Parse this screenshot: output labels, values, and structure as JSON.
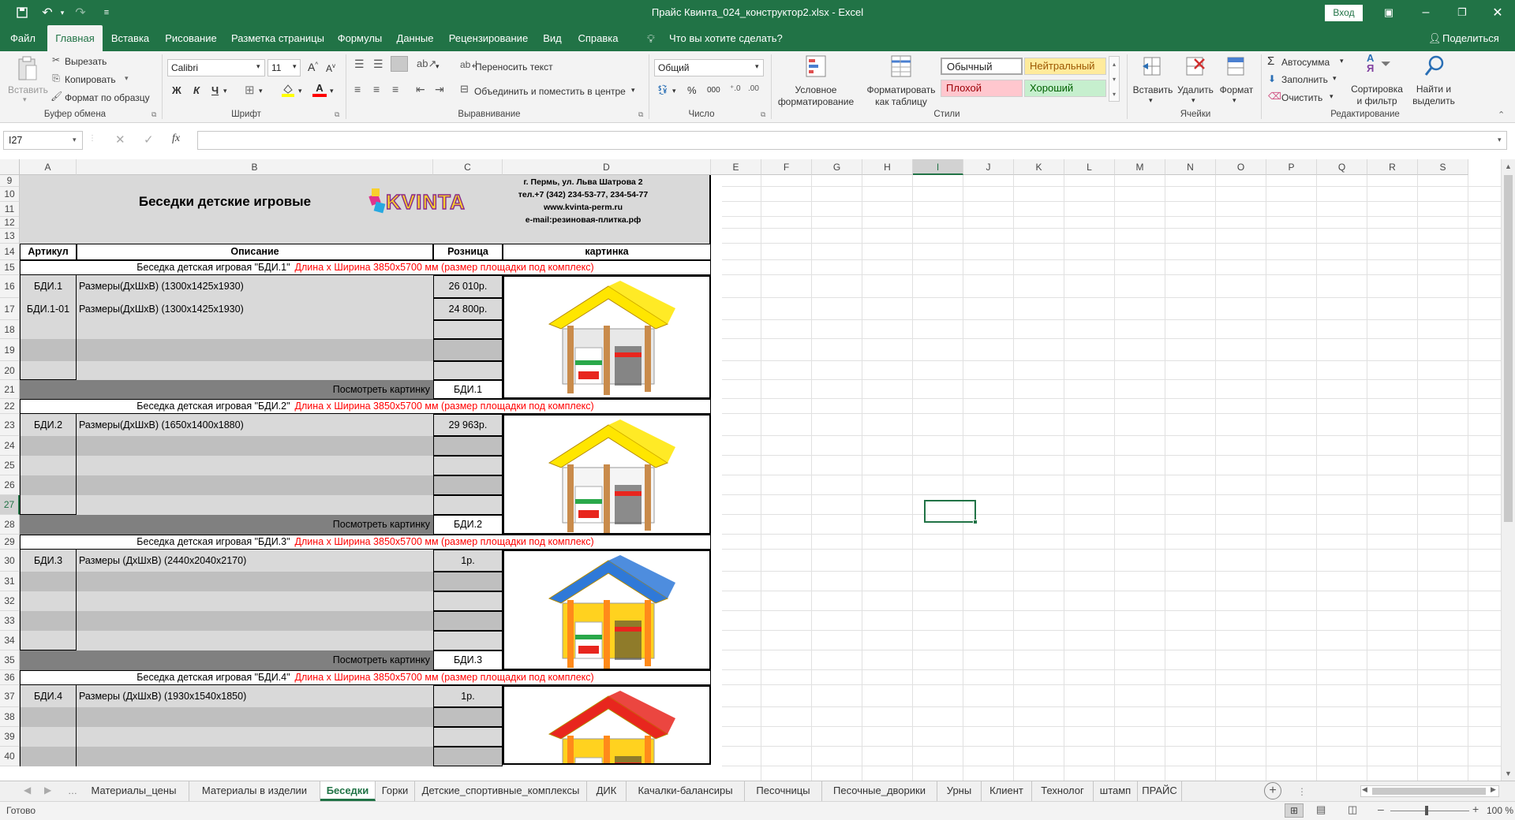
{
  "titlebar": {
    "title": "Прайс Квинта_024_конструктор2.xlsx  -  Excel",
    "signin": "Вход"
  },
  "ribbon_tabs": [
    "Файл",
    "Главная",
    "Вставка",
    "Рисование",
    "Разметка страницы",
    "Формулы",
    "Данные",
    "Рецензирование",
    "Вид",
    "Справка"
  ],
  "tell_me": "Что вы хотите сделать?",
  "share": "Поделиться",
  "clipboard": {
    "paste": "Вставить",
    "cut": "Вырезать",
    "copy": "Копировать",
    "format_painter": "Формат по образцу",
    "label": "Буфер обмена"
  },
  "font": {
    "name": "Calibri",
    "size": "11",
    "bold": "Ж",
    "italic": "К",
    "underline": "Ч",
    "label": "Шрифт"
  },
  "alignment": {
    "wrap": "Переносить текст",
    "merge": "Объединить и поместить в центре",
    "label": "Выравнивание"
  },
  "number": {
    "format": "Общий",
    "label": "Число"
  },
  "styles": {
    "conditional": "Условное форматирование",
    "as_table": "Форматировать как таблицу",
    "normal": "Обычный",
    "neutral": "Нейтральный",
    "bad": "Плохой",
    "good": "Хороший",
    "label": "Стили"
  },
  "cells": {
    "insert": "Вставить",
    "delete": "Удалить",
    "format": "Формат",
    "label": "Ячейки"
  },
  "editing": {
    "autosum": "Автосумма",
    "fill": "Заполнить",
    "clear": "Очистить",
    "sort": "Сортировка и фильтр",
    "find": "Найти и выделить",
    "label": "Редактирование"
  },
  "formula_bar": {
    "namebox": "I27",
    "content": ""
  },
  "columns": [
    "A",
    "B",
    "C",
    "D",
    "E",
    "F",
    "G",
    "H",
    "I",
    "J",
    "K",
    "L",
    "M",
    "N",
    "O",
    "P",
    "Q",
    "R",
    "S"
  ],
  "rows": [
    "9",
    "10",
    "11",
    "12",
    "13",
    "14",
    "15",
    "16",
    "17",
    "18",
    "19",
    "20",
    "21",
    "22",
    "23",
    "24",
    "25",
    "26",
    "27",
    "28",
    "29",
    "30",
    "31",
    "32",
    "33",
    "34",
    "35",
    "36",
    "37",
    "38",
    "39",
    "40"
  ],
  "sheet": {
    "heading": "Беседки детские игровые",
    "logo_text": "KVINTA",
    "address": "г. Пермь, ул. Льва Шатрова 2",
    "phone": "тел.+7 (342) 234-53-77, 234-54-77",
    "site": "www.kvinta-perm.ru",
    "email": "e-mail:резиновая-плитка.рф",
    "hdr_article": "Артикул",
    "hdr_desc": "Описание",
    "hdr_price": "Розница",
    "hdr_pic": "картинка",
    "view_pic": "Посмотреть картинку",
    "dim_note": "Длина х Ширина 3850х5700 мм (размер площадки под комплекс)",
    "groups": [
      {
        "title": "Беседка детская игровая \"БДИ.1\"",
        "link": "БДИ.1",
        "items": [
          {
            "art": "БДИ.1",
            "desc": "Размеры(ДхШхВ) (1300х1425х1930)",
            "price": "26 010р."
          },
          {
            "art": "БДИ.1-01",
            "desc": "Размеры(ДхШхВ) (1300х1425х1930)",
            "price": "24 800р."
          }
        ]
      },
      {
        "title": "Беседка детская игровая \"БДИ.2\"",
        "link": "БДИ.2",
        "items": [
          {
            "art": "БДИ.2",
            "desc": "Размеры(ДхШхВ)  (1650х1400х1880)",
            "price": "29 963р."
          }
        ]
      },
      {
        "title": "Беседка детская игровая \"БДИ.3\"",
        "link": "БДИ.3",
        "items": [
          {
            "art": "БДИ.3",
            "desc": "Размеры (ДхШхВ) (2440х2040х2170)",
            "price": "1р."
          }
        ]
      },
      {
        "title": "Беседка детская игровая \"БДИ.4\"",
        "link": "",
        "items": [
          {
            "art": "БДИ.4",
            "desc": "Размеры (ДхШхВ) (1930х1540х1850)",
            "price": "1р."
          }
        ]
      }
    ]
  },
  "sheet_tabs": [
    "Материалы_цены",
    "Материалы в изделии",
    "Беседки",
    "Горки",
    "Детские_спортивные_комплексы",
    "ДИК",
    "Качалки-балансиры",
    "Песочницы",
    "Песочные_дворики",
    "Урны",
    "Клиент",
    "Технолог",
    "штамп",
    "ПРАЙС"
  ],
  "active_tab": "Беседки",
  "status": {
    "ready": "Готово",
    "zoom": "100 %"
  },
  "colors": {
    "excel_green": "#217346",
    "header_grey": "#d9d9d9",
    "row_dark": "#808080",
    "row_mid": "#bfbfbf",
    "red_text": "#ff0000"
  }
}
